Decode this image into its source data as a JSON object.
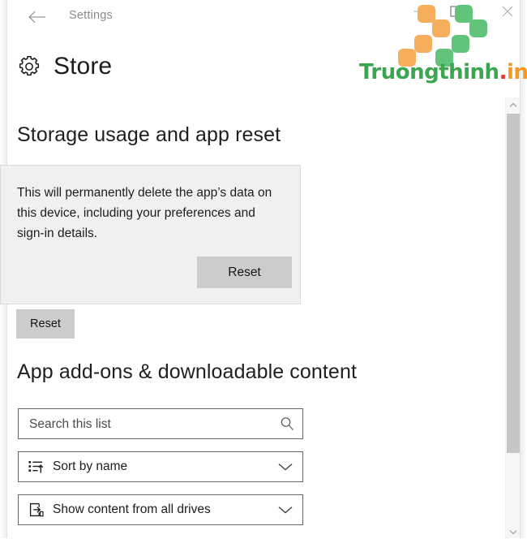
{
  "window": {
    "app_title": "Settings",
    "back_icon": "back-arrow-icon",
    "minimize_label": "—",
    "maximize_label": "☐",
    "close_label": "✕"
  },
  "watermark": {
    "brand_part1": "Truongthinh",
    "brand_dot": ".",
    "brand_part2": "info",
    "colors": {
      "green": "#3aa650",
      "orange": "#f2991f",
      "red": "#e8362a",
      "tile_orange": "#f6ad5c",
      "tile_green": "#62c37a"
    }
  },
  "header": {
    "icon": "gear-icon",
    "title": "Store"
  },
  "storage_section": {
    "title": "Storage usage and app reset",
    "dialog": {
      "message": "This will permanently delete the app’s data on this device, including your preferences and sign-in details.",
      "confirm_label": "Reset"
    },
    "reset_label": "Reset"
  },
  "addons_section": {
    "title": "App add-ons & downloadable content",
    "search": {
      "placeholder": "Search this list",
      "value": "",
      "icon": "search-icon"
    },
    "sort_dropdown": {
      "icon": "sort-ascending-icon",
      "value": "Sort by name",
      "chevron": "chevron-down-icon"
    },
    "drives_dropdown": {
      "icon": "drive-content-icon",
      "value": "Show content from all drives",
      "chevron": "chevron-down-icon"
    }
  },
  "scrollbar": {
    "up_icon": "chevron-up-icon",
    "down_icon": "chevron-down-icon"
  }
}
